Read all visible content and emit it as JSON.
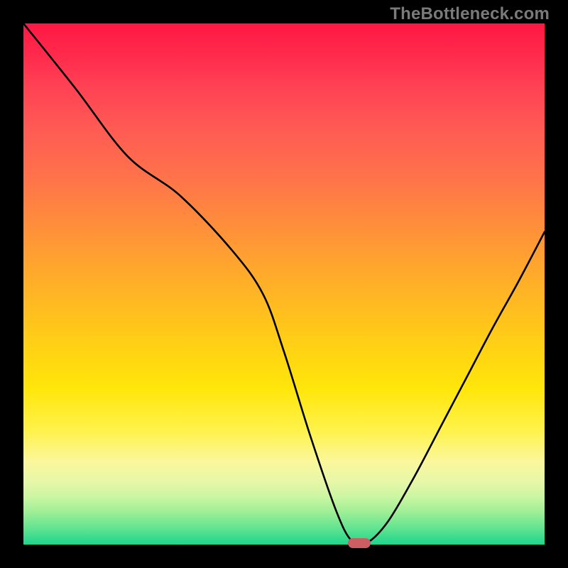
{
  "watermark": "TheBottleneck.com",
  "chart_data": {
    "type": "line",
    "title": "",
    "xlabel": "",
    "ylabel": "",
    "xlim": [
      0,
      100
    ],
    "ylim": [
      0,
      100
    ],
    "axis_ticks_visible": false,
    "grid": false,
    "legend": false,
    "series": [
      {
        "name": "bottleneck-curve",
        "x": [
          0,
          10,
          20,
          30,
          40,
          46,
          50,
          55,
          60,
          63,
          66,
          70,
          75,
          80,
          85,
          90,
          95,
          100
        ],
        "values": [
          100,
          87.5,
          74.5,
          67.0,
          56.5,
          48.0,
          37,
          21,
          6.5,
          0.7,
          0.4,
          4.5,
          13,
          22.5,
          32,
          41.5,
          50.5,
          60
        ]
      }
    ],
    "marker": {
      "name": "optimal-indicator",
      "x": 64.5,
      "y": 0.3,
      "color": "#cb5d63",
      "shape": "pill"
    },
    "background_gradient": {
      "direction": "top-to-bottom",
      "stops": [
        {
          "pos": 0.0,
          "color": "#ff1744"
        },
        {
          "pos": 0.35,
          "color": "#ff7f3a"
        },
        {
          "pos": 0.7,
          "color": "#ffe60a"
        },
        {
          "pos": 0.88,
          "color": "#e6f7a8"
        },
        {
          "pos": 1.0,
          "color": "#1cd68c"
        }
      ]
    }
  }
}
